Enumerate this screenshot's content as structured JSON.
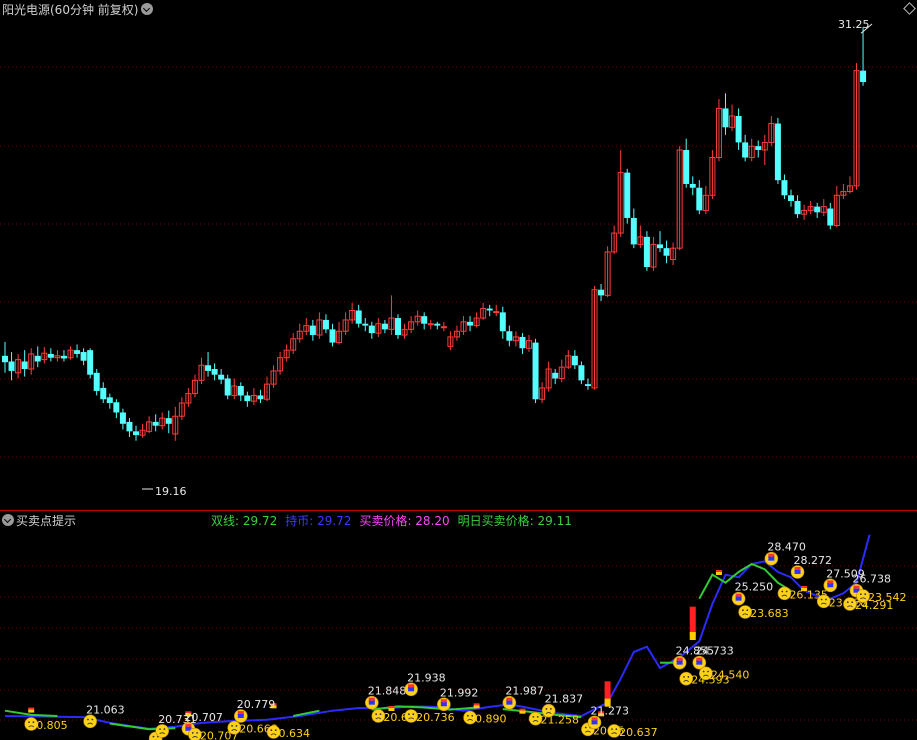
{
  "window": {
    "title": "阳光电源(60分钟 前复权)"
  },
  "sub_panel": {
    "title": "买卖点提示"
  },
  "legend": [
    {
      "label": "双线: 29.72",
      "color": "#3bd13b"
    },
    {
      "label": "持币: 29.72",
      "color": "#3a3aff"
    },
    {
      "label": "买卖价格: 28.20",
      "color": "#ff44ff"
    },
    {
      "label": "明日买卖价格: 29.11",
      "color": "#3bd13b"
    }
  ],
  "colors": {
    "up": "#ff3c3c",
    "down": "#54ffff",
    "grid": "#7a0000",
    "ma_green": "#33cc33",
    "ma_blue": "#2b2bff",
    "face": "#ffd21a",
    "label": "#e8e8e8",
    "sell_bar": "#ff2020"
  },
  "annotations": {
    "high_label": "31.25",
    "low_label": "19.16"
  },
  "chart_data": {
    "type": "candlestick",
    "ylim": [
      18.6,
      31.6
    ],
    "candles": [
      [
        22.55,
        22.38,
        22.92,
        22.1
      ],
      [
        22.4,
        22.15,
        22.65,
        21.9
      ],
      [
        22.1,
        22.45,
        22.6,
        21.95
      ],
      [
        22.4,
        22.2,
        22.7,
        22.0
      ],
      [
        22.2,
        22.6,
        22.75,
        22.05
      ],
      [
        22.55,
        22.4,
        22.8,
        22.25
      ],
      [
        22.45,
        22.62,
        22.78,
        22.35
      ],
      [
        22.6,
        22.5,
        22.75,
        22.4
      ],
      [
        22.5,
        22.55,
        22.7,
        22.4
      ],
      [
        22.55,
        22.48,
        22.7,
        22.4
      ],
      [
        22.5,
        22.7,
        22.8,
        22.45
      ],
      [
        22.7,
        22.6,
        22.85,
        22.5
      ],
      [
        22.65,
        22.42,
        22.75,
        22.3
      ],
      [
        22.7,
        22.05,
        22.75,
        21.95
      ],
      [
        22.1,
        21.62,
        22.2,
        21.5
      ],
      [
        21.7,
        21.4,
        21.85,
        21.3
      ],
      [
        21.45,
        21.3,
        21.55,
        21.15
      ],
      [
        21.32,
        21.05,
        21.4,
        20.9
      ],
      [
        21.05,
        20.75,
        21.15,
        20.6
      ],
      [
        20.8,
        20.55,
        20.9,
        20.4
      ],
      [
        20.55,
        20.45,
        20.7,
        20.3
      ],
      [
        20.45,
        20.58,
        20.75,
        20.38
      ],
      [
        20.55,
        20.8,
        20.95,
        20.5
      ],
      [
        20.8,
        20.7,
        21.0,
        20.55
      ],
      [
        20.7,
        20.9,
        21.05,
        20.6
      ],
      [
        20.9,
        20.75,
        21.1,
        20.5
      ],
      [
        20.48,
        20.95,
        21.2,
        20.3
      ],
      [
        20.95,
        21.3,
        21.45,
        20.85
      ],
      [
        21.3,
        21.55,
        21.7,
        21.2
      ],
      [
        21.55,
        21.9,
        22.05,
        21.45
      ],
      [
        21.9,
        22.3,
        22.5,
        21.8
      ],
      [
        22.3,
        22.15,
        22.65,
        22.0
      ],
      [
        22.2,
        22.05,
        22.35,
        21.9
      ],
      [
        22.05,
        21.92,
        22.2,
        21.8
      ],
      [
        21.95,
        21.5,
        22.05,
        21.4
      ],
      [
        21.5,
        21.75,
        21.95,
        21.4
      ],
      [
        21.75,
        21.5,
        21.85,
        21.35
      ],
      [
        21.5,
        21.35,
        21.6,
        21.2
      ],
      [
        21.35,
        21.5,
        21.7,
        21.25
      ],
      [
        21.5,
        21.4,
        21.65,
        21.3
      ],
      [
        21.4,
        21.8,
        22.0,
        21.35
      ],
      [
        21.8,
        22.15,
        22.3,
        21.7
      ],
      [
        22.15,
        22.5,
        22.65,
        22.05
      ],
      [
        22.5,
        22.7,
        22.85,
        22.4
      ],
      [
        22.7,
        23.0,
        23.15,
        22.6
      ],
      [
        23.0,
        23.2,
        23.4,
        22.9
      ],
      [
        23.2,
        23.35,
        23.55,
        23.1
      ],
      [
        23.35,
        23.1,
        23.5,
        22.95
      ],
      [
        23.1,
        23.5,
        23.7,
        23.0
      ],
      [
        23.5,
        23.25,
        23.65,
        23.15
      ],
      [
        23.25,
        22.9,
        23.4,
        22.8
      ],
      [
        22.9,
        23.2,
        23.45,
        22.85
      ],
      [
        23.2,
        23.5,
        23.7,
        23.1
      ],
      [
        23.5,
        23.75,
        23.95,
        23.4
      ],
      [
        23.75,
        23.4,
        23.9,
        23.3
      ],
      [
        23.4,
        23.35,
        23.55,
        23.2
      ],
      [
        23.35,
        23.15,
        23.45,
        23.0
      ],
      [
        23.15,
        23.4,
        23.55,
        23.05
      ],
      [
        23.4,
        23.25,
        23.5,
        23.15
      ],
      [
        23.25,
        23.55,
        24.15,
        23.1
      ],
      [
        23.55,
        23.1,
        23.65,
        23.0
      ],
      [
        23.1,
        23.25,
        23.4,
        23.0
      ],
      [
        23.25,
        23.45,
        23.6,
        23.15
      ],
      [
        23.45,
        23.6,
        23.75,
        23.35
      ],
      [
        23.6,
        23.4,
        23.7,
        23.25
      ],
      [
        23.4,
        23.4,
        23.5,
        23.25
      ],
      [
        23.4,
        23.35,
        23.45,
        23.25
      ],
      [
        23.3,
        23.32,
        23.45,
        23.2
      ],
      [
        22.8,
        23.05,
        23.2,
        22.7
      ],
      [
        23.05,
        23.2,
        23.35,
        22.95
      ],
      [
        23.2,
        23.45,
        23.6,
        23.1
      ],
      [
        23.45,
        23.35,
        23.6,
        23.2
      ],
      [
        23.35,
        23.55,
        23.7,
        23.3
      ],
      [
        23.55,
        23.8,
        23.95,
        23.5
      ],
      [
        23.8,
        23.75,
        23.9,
        23.6
      ],
      [
        23.7,
        23.72,
        23.9,
        23.6
      ],
      [
        23.7,
        23.2,
        23.85,
        23.0
      ],
      [
        23.2,
        22.95,
        23.35,
        22.8
      ],
      [
        22.95,
        23.05,
        23.2,
        22.8
      ],
      [
        23.05,
        22.75,
        23.15,
        22.6
      ],
      [
        22.75,
        22.95,
        23.1,
        22.65
      ],
      [
        22.9,
        21.4,
        23.0,
        21.3
      ],
      [
        21.4,
        21.7,
        21.85,
        21.3
      ],
      [
        21.7,
        22.2,
        22.4,
        21.6
      ],
      [
        22.1,
        21.95,
        22.2,
        21.8
      ],
      [
        21.95,
        22.25,
        22.45,
        21.85
      ],
      [
        22.25,
        22.55,
        22.7,
        22.2
      ],
      [
        22.55,
        22.3,
        22.7,
        22.2
      ],
      [
        22.3,
        21.9,
        22.4,
        21.8
      ],
      [
        21.8,
        21.75,
        21.95,
        21.65
      ],
      [
        21.7,
        24.3,
        24.4,
        21.65
      ],
      [
        24.3,
        24.15,
        24.45,
        24.0
      ],
      [
        24.15,
        25.3,
        25.45,
        24.1
      ],
      [
        25.3,
        25.8,
        26.0,
        25.25
      ],
      [
        25.8,
        27.4,
        28.0,
        25.7
      ],
      [
        27.4,
        26.2,
        27.5,
        26.05
      ],
      [
        26.2,
        25.5,
        26.45,
        25.4
      ],
      [
        25.5,
        25.7,
        26.0,
        25.4
      ],
      [
        25.7,
        24.9,
        25.85,
        24.8
      ],
      [
        24.9,
        25.5,
        25.7,
        24.8
      ],
      [
        25.5,
        25.4,
        25.85,
        25.3
      ],
      [
        25.4,
        25.2,
        25.6,
        25.0
      ],
      [
        25.1,
        25.4,
        25.55,
        24.95
      ],
      [
        25.4,
        28.0,
        28.1,
        25.35
      ],
      [
        28.0,
        27.1,
        28.3,
        27.0
      ],
      [
        27.1,
        27.0,
        27.3,
        26.8
      ],
      [
        27.0,
        26.4,
        27.2,
        26.3
      ],
      [
        26.4,
        26.8,
        27.05,
        26.3
      ],
      [
        26.8,
        27.8,
        28.0,
        26.7
      ],
      [
        27.8,
        29.1,
        29.35,
        27.7
      ],
      [
        29.1,
        28.6,
        29.5,
        28.4
      ],
      [
        28.6,
        28.9,
        29.2,
        28.5
      ],
      [
        28.9,
        28.2,
        29.1,
        28.0
      ],
      [
        28.2,
        27.8,
        28.4,
        27.7
      ],
      [
        27.8,
        28.1,
        28.3,
        27.7
      ],
      [
        28.1,
        28.0,
        28.25,
        27.8
      ],
      [
        28.0,
        28.2,
        28.4,
        27.6
      ],
      [
        28.2,
        28.7,
        28.9,
        28.1
      ],
      [
        28.7,
        27.2,
        28.85,
        27.1
      ],
      [
        27.2,
        26.8,
        27.35,
        26.7
      ],
      [
        26.8,
        26.65,
        26.95,
        26.5
      ],
      [
        26.65,
        26.3,
        26.8,
        26.2
      ],
      [
        26.3,
        26.4,
        26.55,
        26.15
      ],
      [
        26.4,
        26.5,
        26.65,
        26.3
      ],
      [
        26.5,
        26.35,
        26.6,
        26.2
      ],
      [
        26.35,
        26.5,
        26.7,
        26.25
      ],
      [
        26.45,
        26.0,
        26.6,
        25.9
      ],
      [
        26.0,
        26.8,
        27.05,
        25.95
      ],
      [
        26.8,
        26.9,
        27.1,
        26.7
      ],
      [
        26.9,
        27.05,
        27.3,
        26.85
      ],
      [
        27.05,
        30.1,
        30.3,
        26.95
      ],
      [
        30.1,
        29.8,
        31.25,
        29.7
      ]
    ],
    "ma_blue": [
      [
        0,
        22.7
      ],
      [
        12,
        22.68
      ],
      [
        16,
        22.57
      ],
      [
        22,
        22.46
      ],
      [
        26,
        22.5
      ],
      [
        30,
        22.57
      ],
      [
        34,
        22.6
      ],
      [
        40,
        22.63
      ],
      [
        45,
        22.7
      ],
      [
        50,
        22.8
      ],
      [
        54,
        22.85
      ],
      [
        58,
        22.84
      ],
      [
        62,
        22.88
      ],
      [
        66,
        22.87
      ],
      [
        70,
        22.8
      ],
      [
        74,
        22.87
      ],
      [
        77,
        22.92
      ],
      [
        80,
        22.85
      ],
      [
        84,
        22.75
      ],
      [
        88,
        22.7
      ],
      [
        92,
        22.95
      ],
      [
        94,
        23.4
      ],
      [
        96,
        23.9
      ],
      [
        98,
        24.0
      ],
      [
        100,
        23.6
      ],
      [
        103,
        23.8
      ],
      [
        106,
        24.1
      ],
      [
        108,
        24.8
      ],
      [
        110,
        25.35
      ],
      [
        112,
        25.3
      ],
      [
        114,
        25.55
      ],
      [
        116,
        25.6
      ],
      [
        118,
        25.4
      ],
      [
        120,
        25.3
      ],
      [
        122,
        25.05
      ],
      [
        124,
        24.95
      ],
      [
        126,
        24.9
      ],
      [
        128,
        25.0
      ],
      [
        130,
        25.2
      ],
      [
        132,
        26.1
      ]
    ],
    "ma_green_segments": [
      [
        [
          0,
          22.8
        ],
        [
          4,
          22.72
        ],
        [
          8,
          22.7
        ]
      ],
      [
        [
          16,
          22.56
        ],
        [
          22,
          22.45
        ],
        [
          26,
          22.47
        ]
      ],
      [
        [
          44,
          22.7
        ],
        [
          48,
          22.8
        ]
      ],
      [
        [
          56,
          22.82
        ],
        [
          60,
          22.88
        ],
        [
          64,
          22.86
        ],
        [
          68,
          22.82
        ],
        [
          72,
          22.86
        ]
      ],
      [
        [
          76,
          22.83
        ],
        [
          80,
          22.78
        ],
        [
          84,
          22.72
        ],
        [
          88,
          22.68
        ]
      ],
      [
        [
          100,
          23.7
        ],
        [
          102,
          23.7
        ]
      ],
      [
        [
          106,
          24.9
        ],
        [
          108,
          25.35
        ],
        [
          110,
          25.2
        ],
        [
          112,
          25.4
        ],
        [
          114,
          25.55
        ],
        [
          116,
          25.45
        ],
        [
          118,
          25.2
        ],
        [
          120,
          25.05
        ]
      ]
    ],
    "sub_ylim": [
      22.25,
      26.15
    ],
    "sell_bars": [
      [
        92,
        22.95,
        23.35
      ],
      [
        105,
        24.2,
        24.75
      ]
    ],
    "small_markers": [
      [
        4,
        22.82
      ],
      [
        28,
        22.75
      ],
      [
        41,
        22.9
      ],
      [
        59,
        22.85
      ],
      [
        72,
        22.9
      ],
      [
        79,
        22.8
      ],
      [
        91,
        22.75
      ],
      [
        109,
        25.4
      ],
      [
        122,
        25.1
      ]
    ],
    "face_markers": [
      [
        4,
        22.55,
        "sad",
        "0.805",
        0.7
      ],
      [
        13,
        22.6,
        "sad",
        "21.063",
        -0.3
      ],
      [
        23,
        22.28,
        "sad",
        "",
        0
      ],
      [
        24,
        22.42,
        "sad",
        "20.731",
        -0.3
      ],
      [
        28,
        22.46,
        "happy",
        "20.707",
        -0.3
      ],
      [
        29,
        22.35,
        "sad",
        "20.707",
        0.7
      ],
      [
        35,
        22.48,
        "sad",
        "20.668",
        0.7
      ],
      [
        36,
        22.7,
        "happy",
        "20.779",
        -0.3
      ],
      [
        41,
        22.4,
        "sad",
        "0.634",
        0.7
      ],
      [
        56,
        22.95,
        "happy",
        "21.848",
        -0.3
      ],
      [
        57,
        22.7,
        "sad",
        "20.63",
        0.7
      ],
      [
        62,
        22.7,
        "sad",
        "20.736",
        0.7
      ],
      [
        62,
        23.2,
        "happy",
        "21.938",
        -0.3
      ],
      [
        67,
        22.92,
        "happy",
        "21.992",
        -0.3
      ],
      [
        71,
        22.67,
        "sad",
        "0.890",
        0.7
      ],
      [
        77,
        22.95,
        "happy",
        "21.987",
        -0.3
      ],
      [
        81,
        22.65,
        "sad",
        "21.258",
        0.7
      ],
      [
        83,
        22.8,
        "sad",
        "21.837",
        -0.3
      ],
      [
        89,
        22.45,
        "sad",
        "20.75",
        0.7
      ],
      [
        90,
        22.58,
        "happy",
        "21.273",
        -0.3
      ],
      [
        93,
        22.42,
        "sad",
        "20.637",
        0.7
      ],
      [
        103,
        23.7,
        "happy",
        "24.855",
        -0.3
      ],
      [
        104,
        23.4,
        "sad",
        "24.593",
        0.7
      ],
      [
        106,
        23.7,
        "happy",
        "24.733",
        -0.3
      ],
      [
        107,
        23.5,
        "sad",
        "24.540",
        0.7
      ],
      [
        112,
        24.9,
        "happy",
        "25.250",
        -0.3
      ],
      [
        113,
        24.65,
        "sad",
        "23.683",
        0.7
      ],
      [
        117,
        25.65,
        "happy",
        "28.470",
        -0.3
      ],
      [
        119,
        25.0,
        "sad",
        "26.135",
        0.7
      ],
      [
        121,
        25.4,
        "happy",
        "28.272",
        -0.3
      ],
      [
        125,
        24.85,
        "sad",
        "23.828",
        0.7
      ],
      [
        126,
        25.15,
        "happy",
        "27.509",
        -0.3
      ],
      [
        129,
        24.8,
        "sad",
        "24.291",
        0.7
      ],
      [
        130,
        25.05,
        "happy",
        "26.738",
        -0.3
      ],
      [
        131,
        24.95,
        "sad",
        "23.542",
        0.7
      ]
    ]
  }
}
